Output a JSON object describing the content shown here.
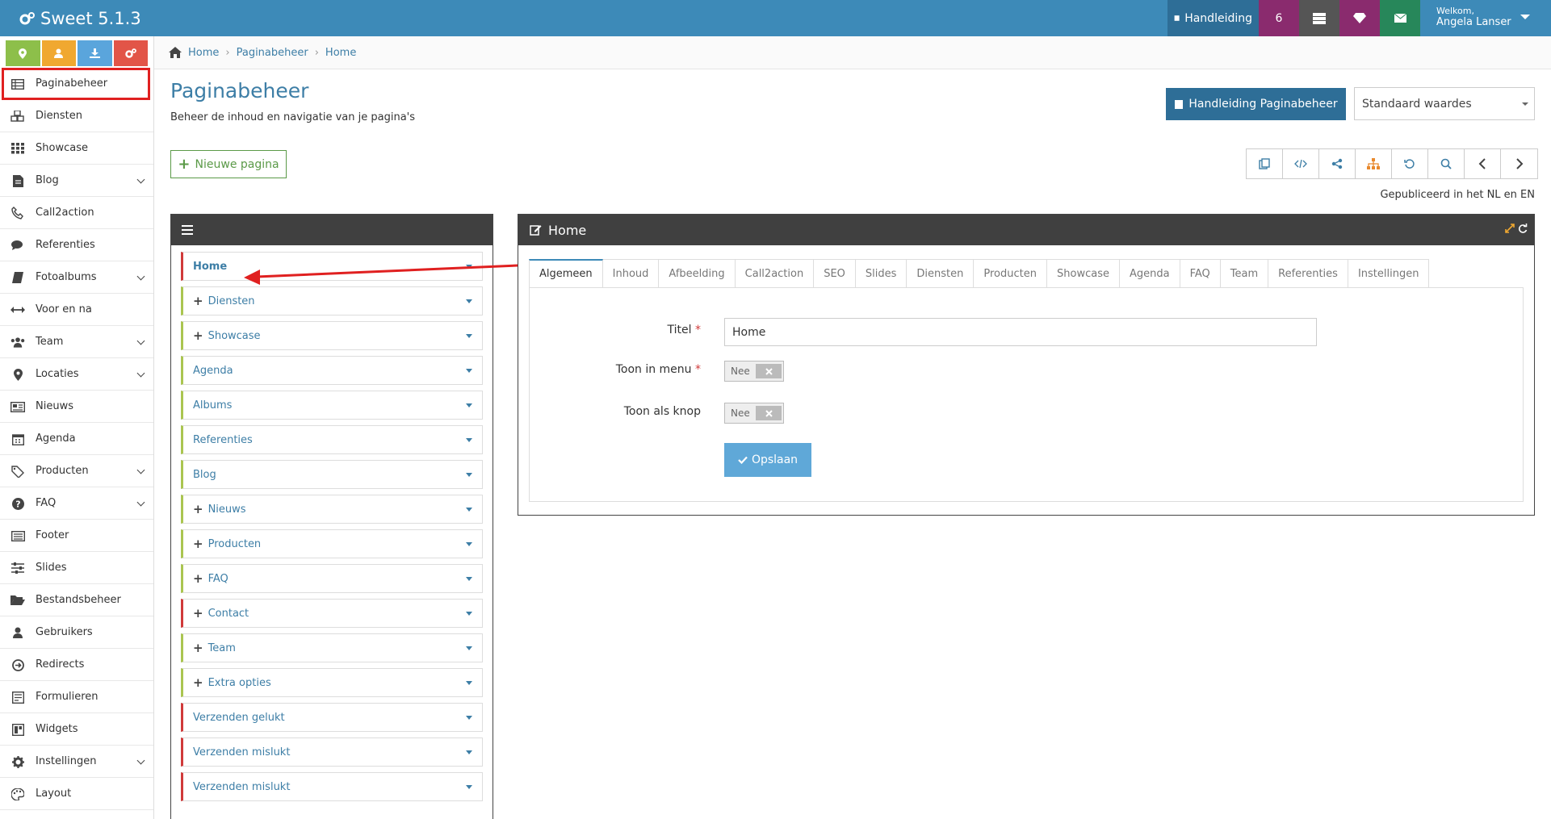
{
  "app": {
    "title": "Sweet 5.1.3"
  },
  "topbar": {
    "handleiding": "Handleiding",
    "count": "6",
    "welcome": "Welkom,",
    "user": "Angela Lanser"
  },
  "quick_buttons": [
    {
      "icon": "map-marker-icon",
      "color": "#8dbf4a"
    },
    {
      "icon": "user-icon",
      "color": "#f0a830"
    },
    {
      "icon": "download-icon",
      "color": "#5aa5dc"
    },
    {
      "icon": "cogs-icon",
      "color": "#e25548"
    }
  ],
  "sidebar": {
    "items": [
      {
        "label": "Paginabeheer",
        "icon": "table-icon",
        "chevron": false,
        "active": true
      },
      {
        "label": "Diensten",
        "icon": "cubes-icon",
        "chevron": false
      },
      {
        "label": "Showcase",
        "icon": "grid-icon",
        "chevron": false
      },
      {
        "label": "Blog",
        "icon": "document-icon",
        "chevron": true
      },
      {
        "label": "Call2action",
        "icon": "phone-icon",
        "chevron": false
      },
      {
        "label": "Referenties",
        "icon": "comments-icon",
        "chevron": false
      },
      {
        "label": "Fotoalbums",
        "icon": "book-icon",
        "chevron": true
      },
      {
        "label": "Voor en na",
        "icon": "arrows-h-icon",
        "chevron": false
      },
      {
        "label": "Team",
        "icon": "users-icon",
        "chevron": true
      },
      {
        "label": "Locaties",
        "icon": "map-marker-icon",
        "chevron": true
      },
      {
        "label": "Nieuws",
        "icon": "newspaper-icon",
        "chevron": false
      },
      {
        "label": "Agenda",
        "icon": "calendar-icon",
        "chevron": false
      },
      {
        "label": "Producten",
        "icon": "tags-icon",
        "chevron": true
      },
      {
        "label": "FAQ",
        "icon": "question-icon",
        "chevron": true
      },
      {
        "label": "Footer",
        "icon": "list-alt-icon",
        "chevron": false
      },
      {
        "label": "Slides",
        "icon": "sliders-icon",
        "chevron": false
      },
      {
        "label": "Bestandsbeheer",
        "icon": "folder-open-icon",
        "chevron": false
      },
      {
        "label": "Gebruikers",
        "icon": "user-icon",
        "chevron": false
      },
      {
        "label": "Redirects",
        "icon": "arrow-circle-icon",
        "chevron": false
      },
      {
        "label": "Formulieren",
        "icon": "form-icon",
        "chevron": false
      },
      {
        "label": "Widgets",
        "icon": "widgets-icon",
        "chevron": false
      },
      {
        "label": "Instellingen",
        "icon": "gear-icon",
        "chevron": true
      },
      {
        "label": "Layout",
        "icon": "palette-icon",
        "chevron": false
      }
    ]
  },
  "breadcrumb": [
    "Home",
    "Paginabeheer",
    "Home"
  ],
  "page": {
    "title": "Paginabeheer",
    "subtitle": "Beheer de inhoud en navigatie van je pagina's",
    "manual_button": "Handleiding Paginabeheer",
    "select_value": "Standaard waardes",
    "new_button": "Nieuwe pagina",
    "published": "Gepubliceerd in het NL en EN"
  },
  "pages_list": [
    {
      "label": "Home",
      "plus": false,
      "color": "red",
      "selected": true
    },
    {
      "label": "Diensten",
      "plus": true,
      "color": "green"
    },
    {
      "label": "Showcase",
      "plus": true,
      "color": "green"
    },
    {
      "label": "Agenda",
      "plus": false,
      "color": "green"
    },
    {
      "label": "Albums",
      "plus": false,
      "color": "green"
    },
    {
      "label": "Referenties",
      "plus": false,
      "color": "green"
    },
    {
      "label": "Blog",
      "plus": false,
      "color": "green"
    },
    {
      "label": "Nieuws",
      "plus": true,
      "color": "green"
    },
    {
      "label": "Producten",
      "plus": true,
      "color": "green"
    },
    {
      "label": "FAQ",
      "plus": true,
      "color": "green"
    },
    {
      "label": "Contact",
      "plus": true,
      "color": "red"
    },
    {
      "label": "Team",
      "plus": true,
      "color": "green"
    },
    {
      "label": "Extra opties",
      "plus": true,
      "color": "green"
    },
    {
      "label": "Verzenden gelukt",
      "plus": false,
      "color": "red"
    },
    {
      "label": "Verzenden mislukt",
      "plus": false,
      "color": "red"
    },
    {
      "label": "Verzenden mislukt",
      "plus": false,
      "color": "red"
    }
  ],
  "editor": {
    "title": "Home",
    "tabs": [
      "Algemeen",
      "Inhoud",
      "Afbeelding",
      "Call2action",
      "SEO",
      "Slides",
      "Diensten",
      "Producten",
      "Showcase",
      "Agenda",
      "FAQ",
      "Team",
      "Referenties",
      "Instellingen"
    ],
    "fields": {
      "titel_label": "Titel",
      "titel_value": "Home",
      "menu_label": "Toon in menu",
      "menu_value": "Nee",
      "knop_label": "Toon als knop",
      "knop_value": "Nee",
      "req": "*"
    },
    "save_label": "Opslaan"
  }
}
